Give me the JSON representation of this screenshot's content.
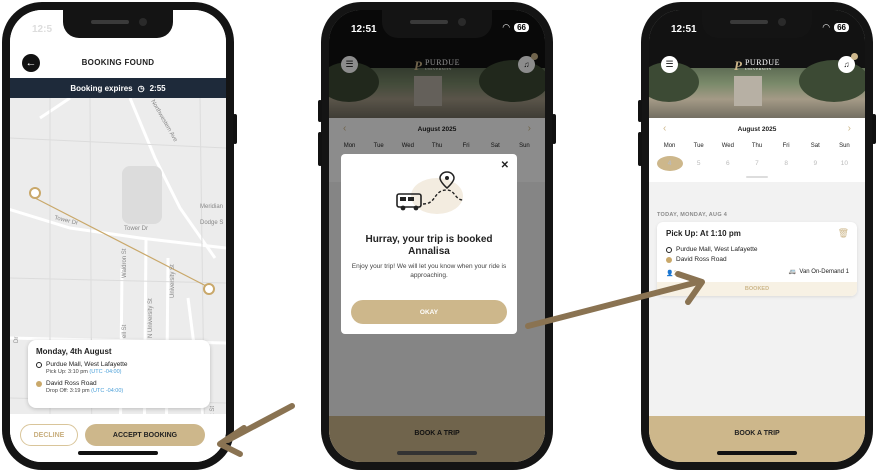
{
  "colors": {
    "accent": "#cdb78b",
    "dark_bar": "#1e2a3a",
    "timezone": "#4a9fd8"
  },
  "phone1": {
    "status_time": "12:5",
    "title": "BOOKING FOUND",
    "expiry_label": "Booking expires",
    "expiry_time": "2:55",
    "map_labels": {
      "northwestern": "Northwestern Ave",
      "tower_dr_left": "Tower Dr",
      "tower_dr_right": "Tower Dr",
      "meridian": "Meridian",
      "dodge": "Dodge S",
      "waldron": "Waldron St",
      "n_university": "N University St",
      "university": "University St",
      "russell": "ell St",
      "dr": "Dr",
      "sheetz": "heetz St"
    },
    "trip": {
      "date": "Monday, 4th August",
      "pickup_place": "Purdue Mall, West Lafayette",
      "pickup_time": "Pick Up: 3:10 pm",
      "pickup_tz": "(UTC -04:00)",
      "dropoff_place": "David Ross Road",
      "dropoff_time": "Drop Off: 3:19 pm",
      "dropoff_tz": "(UTC -04:00)"
    },
    "decline_label": "DECLINE",
    "accept_label": "ACCEPT BOOKING"
  },
  "phone2": {
    "status_time": "12:51",
    "battery": "66",
    "logo_main": "PURDUE",
    "logo_sub": "UNIVERSITY",
    "calendar": {
      "month": "August 2025",
      "days": [
        "Mon",
        "Tue",
        "Wed",
        "Thu",
        "Fri",
        "Sat",
        "Sun"
      ]
    },
    "modal": {
      "close": "✕",
      "title": "Hurray, your trip is booked Annalisa",
      "message": "Enjoy your trip! We will let you know when your ride is approaching.",
      "ok_label": "OKAY"
    },
    "book_label": "BOOK A TRIP"
  },
  "phone3": {
    "status_time": "12:51",
    "battery": "66",
    "logo_main": "PURDUE",
    "logo_sub": "UNIVERSITY",
    "calendar": {
      "month": "August 2025",
      "days": [
        "Mon",
        "Tue",
        "Wed",
        "Thu",
        "Fri",
        "Sat",
        "Sun"
      ],
      "dates": [
        "4",
        "5",
        "6",
        "7",
        "8",
        "9",
        "10"
      ],
      "selected": "4"
    },
    "section_label": "TODAY, MONDAY, AUG 4",
    "booking": {
      "title": "Pick Up: At 1:10 pm",
      "pickup": "Purdue Mall, West Lafayette",
      "dropoff": "David Ross Road",
      "passengers": "2",
      "vehicle": "Van On-Demand 1",
      "status": "BOOKED"
    },
    "book_label": "BOOK A TRIP"
  },
  "icons": [
    "back-arrow-icon",
    "clock-icon",
    "map-pin-icon",
    "menu-icon",
    "bell-icon",
    "close-icon",
    "bus-icon",
    "trash-icon",
    "person-icon",
    "van-icon",
    "arrow-pointer-icon"
  ]
}
